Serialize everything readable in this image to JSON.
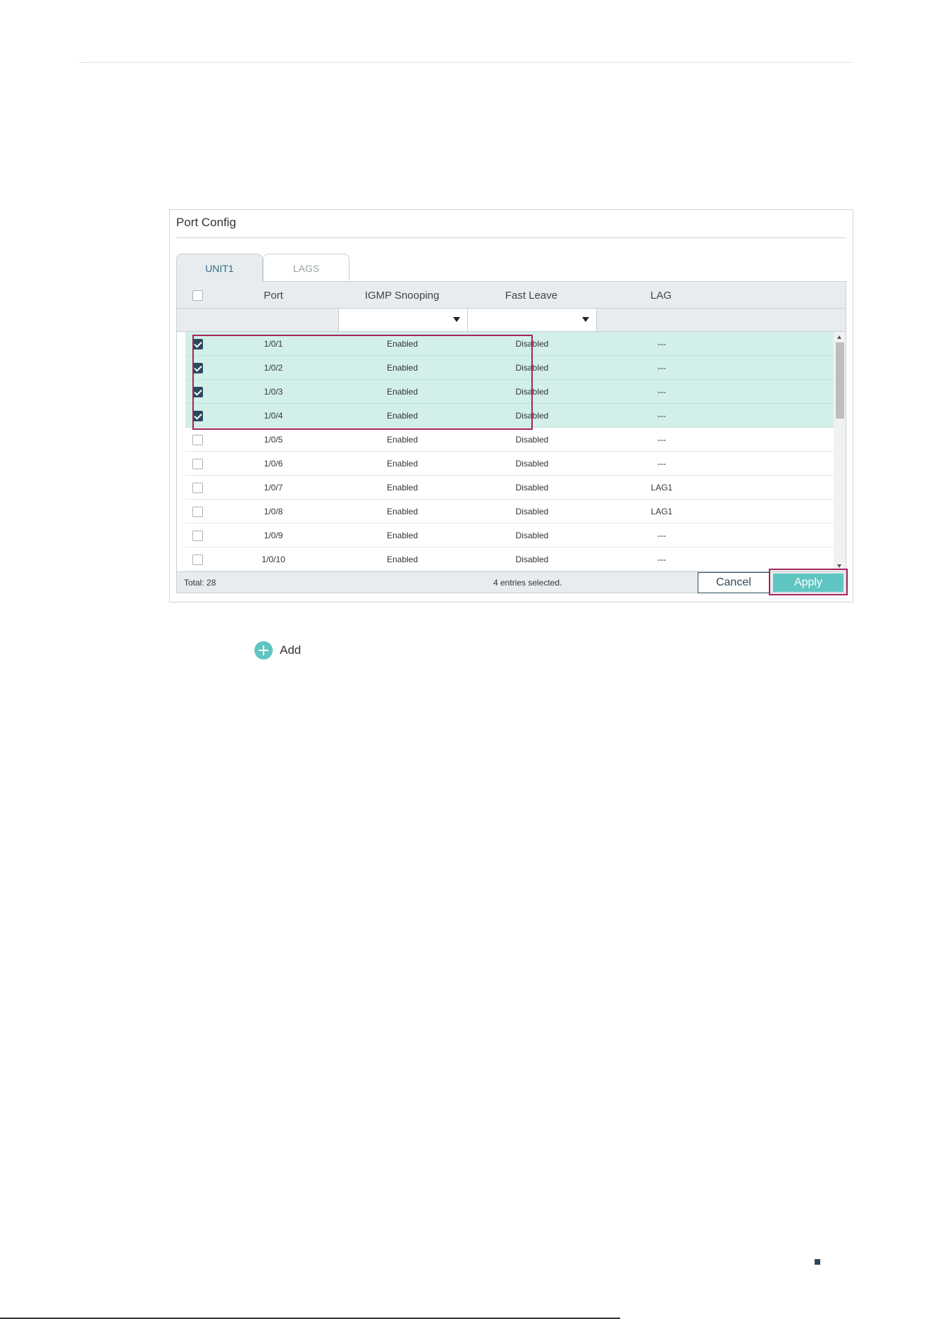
{
  "panel": {
    "title": "Port Config",
    "tabs": [
      {
        "label": "UNIT1",
        "active": true
      },
      {
        "label": "LAGS",
        "active": false
      }
    ],
    "columns": {
      "port": "Port",
      "igmp": "IGMP Snooping",
      "fast_leave": "Fast Leave",
      "lag": "LAG"
    },
    "rows": [
      {
        "checked": true,
        "port": "1/0/1",
        "igmp": "Enabled",
        "fast_leave": "Disabled",
        "lag": "---"
      },
      {
        "checked": true,
        "port": "1/0/2",
        "igmp": "Enabled",
        "fast_leave": "Disabled",
        "lag": "---"
      },
      {
        "checked": true,
        "port": "1/0/3",
        "igmp": "Enabled",
        "fast_leave": "Disabled",
        "lag": "---"
      },
      {
        "checked": true,
        "port": "1/0/4",
        "igmp": "Enabled",
        "fast_leave": "Disabled",
        "lag": "---"
      },
      {
        "checked": false,
        "port": "1/0/5",
        "igmp": "Enabled",
        "fast_leave": "Disabled",
        "lag": "---"
      },
      {
        "checked": false,
        "port": "1/0/6",
        "igmp": "Enabled",
        "fast_leave": "Disabled",
        "lag": "---"
      },
      {
        "checked": false,
        "port": "1/0/7",
        "igmp": "Enabled",
        "fast_leave": "Disabled",
        "lag": "LAG1"
      },
      {
        "checked": false,
        "port": "1/0/8",
        "igmp": "Enabled",
        "fast_leave": "Disabled",
        "lag": "LAG1"
      },
      {
        "checked": false,
        "port": "1/0/9",
        "igmp": "Enabled",
        "fast_leave": "Disabled",
        "lag": "---"
      },
      {
        "checked": false,
        "port": "1/0/10",
        "igmp": "Enabled",
        "fast_leave": "Disabled",
        "lag": "---"
      }
    ],
    "footer": {
      "total": "Total: 28",
      "selected": "4 entries selected.",
      "cancel_label": "Cancel",
      "apply_label": "Apply"
    }
  },
  "add": {
    "label": "Add"
  },
  "colors": {
    "accent": "#5fc5c1",
    "selected_row": "#d3efea",
    "highlight": "#a3245a",
    "checkbox": "#2d4a5a"
  }
}
